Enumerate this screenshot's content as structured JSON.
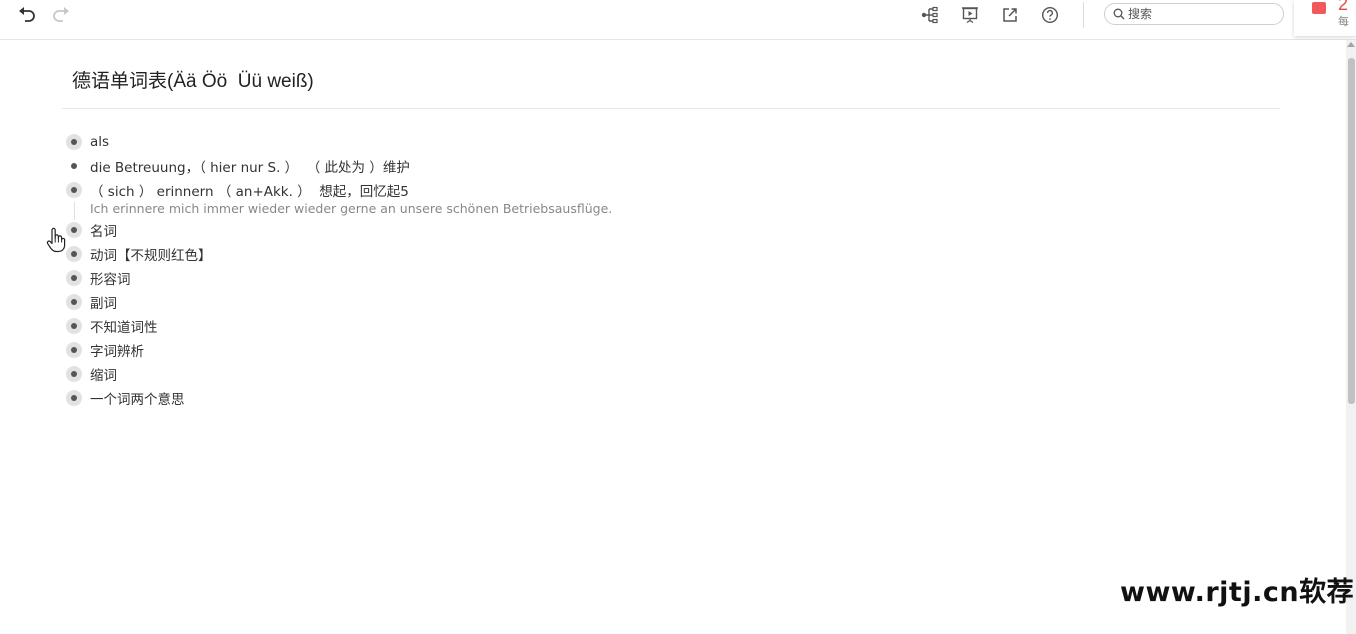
{
  "toolbar": {
    "undo_icon": "undo-icon",
    "redo_icon": "redo-icon",
    "mindmap_icon": "mindmap-icon",
    "present_icon": "present-icon",
    "export_icon": "export-icon",
    "help_icon": "help-icon",
    "search_placeholder": "搜索"
  },
  "notification": {
    "number": "2",
    "subtext": "每"
  },
  "document": {
    "title": "德语单词表(Ää Öö  Üü weiß)",
    "nodes": [
      {
        "text": "als",
        "has_children": true
      },
      {
        "text": "die Betreuung，（ hier nur S. ）  （ 此处为 ）维护",
        "has_children": false
      },
      {
        "text": "（ sich ） erinnern （ an+Akk. ）  想起，回忆起5",
        "has_children": true,
        "note": "Ich erinnere mich immer wieder wieder gerne an unsere schönen Betriebsausflüge."
      },
      {
        "text": "名词",
        "has_children": true
      },
      {
        "text": "动词【不规则红色】",
        "has_children": true
      },
      {
        "text": "形容词",
        "has_children": true
      },
      {
        "text": "副词",
        "has_children": true
      },
      {
        "text": "不知道词性",
        "has_children": true
      },
      {
        "text": "字词辨析",
        "has_children": true
      },
      {
        "text": "缩词",
        "has_children": true
      },
      {
        "text": "一个词两个意思",
        "has_children": true
      }
    ]
  },
  "watermark": "www.rjtj.cn软荐网",
  "colors": {
    "accent_red": "#e94848",
    "bullet_bg": "#e2e2e2",
    "note_text": "#888888"
  }
}
